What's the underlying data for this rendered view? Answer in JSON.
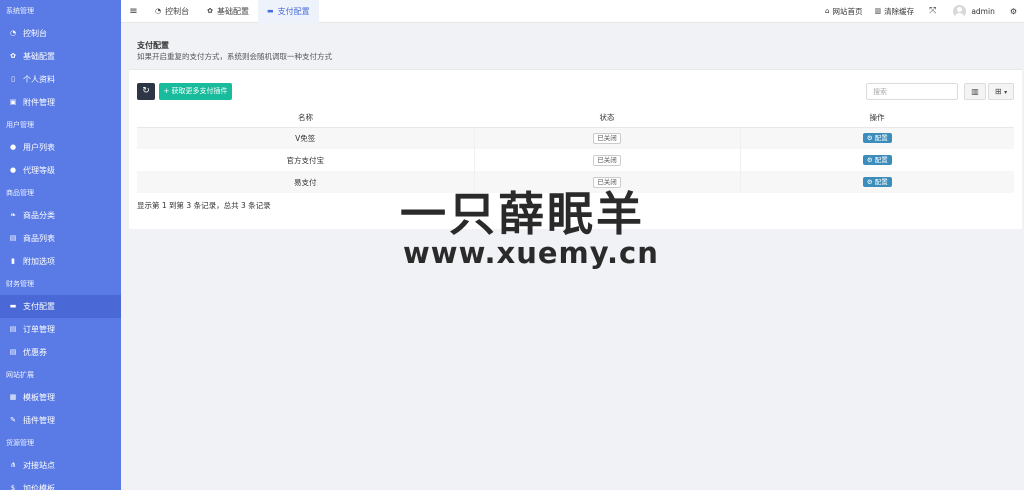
{
  "sidebar": {
    "groups": [
      {
        "label": "系统管理",
        "items": [
          {
            "label": "控制台",
            "icon": "dashboard-icon"
          },
          {
            "label": "基础配置",
            "icon": "gear-icon"
          },
          {
            "label": "个人资料",
            "icon": "file-icon"
          },
          {
            "label": "附件管理",
            "icon": "image-icon"
          }
        ]
      },
      {
        "label": "用户管理",
        "items": [
          {
            "label": "用户列表",
            "icon": "user-icon"
          },
          {
            "label": "代理等级",
            "icon": "user-icon"
          }
        ]
      },
      {
        "label": "商品管理",
        "items": [
          {
            "label": "商品分类",
            "icon": "leaf-icon"
          },
          {
            "label": "商品列表",
            "icon": "list-icon"
          },
          {
            "label": "附加选项",
            "icon": "bookmark-icon"
          }
        ]
      },
      {
        "label": "财务管理",
        "items": [
          {
            "label": "支付配置",
            "icon": "card-icon"
          },
          {
            "label": "订单管理",
            "icon": "list-icon"
          },
          {
            "label": "优惠券",
            "icon": "list-icon"
          }
        ]
      },
      {
        "label": "网站扩展",
        "items": [
          {
            "label": "模板管理",
            "icon": "template-icon"
          },
          {
            "label": "插件管理",
            "icon": "puzzle-icon"
          }
        ]
      },
      {
        "label": "货源管理",
        "items": [
          {
            "label": "对接站点",
            "icon": "share-icon"
          },
          {
            "label": "加价模板",
            "icon": "dollar-icon"
          }
        ]
      }
    ]
  },
  "topbar": {
    "tabs": [
      {
        "label": "控制台",
        "icon": "dashboard-icon"
      },
      {
        "label": "基础配置",
        "icon": "gear-icon"
      },
      {
        "label": "支付配置",
        "icon": "card-icon"
      }
    ],
    "home_link": "网站首页",
    "clear_cache": "清除缓存",
    "user": "admin"
  },
  "panel": {
    "title": "支付配置",
    "desc": "如果开启重复的支付方式，系统则会随机调取一种支付方式",
    "get_button": "获取更多支付插件",
    "search_placeholder": "搜索",
    "columns": [
      "名称",
      "状态",
      "操作"
    ],
    "rows": [
      {
        "name": "V免签",
        "status": "已关闭",
        "action": "配置"
      },
      {
        "name": "官方支付宝",
        "status": "已关闭",
        "action": "配置"
      },
      {
        "name": "易支付",
        "status": "已关闭",
        "action": "配置"
      }
    ],
    "pagination": "显示第 1 到第 3 条记录，总共 3 条记录"
  },
  "watermark": {
    "line1": "一只薛眠羊",
    "line2": "www.xuemy.cn"
  }
}
